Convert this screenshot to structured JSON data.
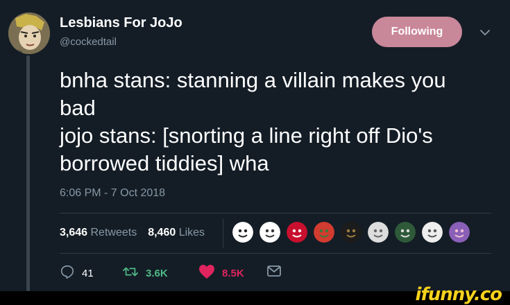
{
  "tweet": {
    "display_name": "Lesbians For JoJo",
    "handle": "@cockedtail",
    "follow_button_label": "Following",
    "text_lines": [
      "bnha stans: stanning a villain makes you",
      "bad",
      "jojo stans: [snorting a line right off Dio's",
      "borrowed tiddies] wha"
    ],
    "timestamp": "6:06 PM - 7 Oct 2018"
  },
  "stats": {
    "retweets_count": "3,646",
    "retweets_label": "Retweets",
    "likes_count": "8,460",
    "likes_label": "Likes"
  },
  "liker_avatars": [
    {
      "name": "liker-avatar-robot",
      "colors": [
        "#ffffff",
        "#222222"
      ]
    },
    {
      "name": "liker-avatar-smiley",
      "colors": [
        "#ffffff",
        "#333333"
      ]
    },
    {
      "name": "liker-avatar-hello-kitty-stop",
      "colors": [
        "#c8102e",
        "#ffffff"
      ]
    },
    {
      "name": "liker-avatar-anime-red",
      "colors": [
        "#d23b2f",
        "#3c7a3a"
      ]
    },
    {
      "name": "liker-avatar-dark-figure",
      "colors": [
        "#1c1c1c",
        "#a08040"
      ]
    },
    {
      "name": "liker-avatar-sketch",
      "colors": [
        "#dddddd",
        "#666666"
      ]
    },
    {
      "name": "liker-avatar-green-character",
      "colors": [
        "#2e5a3a",
        "#dddddd"
      ]
    },
    {
      "name": "liker-avatar-manga",
      "colors": [
        "#eeeeee",
        "#555555"
      ]
    },
    {
      "name": "liker-avatar-purple-anime",
      "colors": [
        "#8a5fb8",
        "#f0c0d0"
      ]
    }
  ],
  "actions": {
    "reply_count": "41",
    "retweet_count": "3.6K",
    "like_count": "8.5K"
  },
  "colors": {
    "background": "#141d26",
    "follow_button": "#c9879a",
    "secondary_text": "#8899a6",
    "retweet_green": "#4fb987",
    "like_red": "#e0245e"
  },
  "watermark": "ifunny.co"
}
